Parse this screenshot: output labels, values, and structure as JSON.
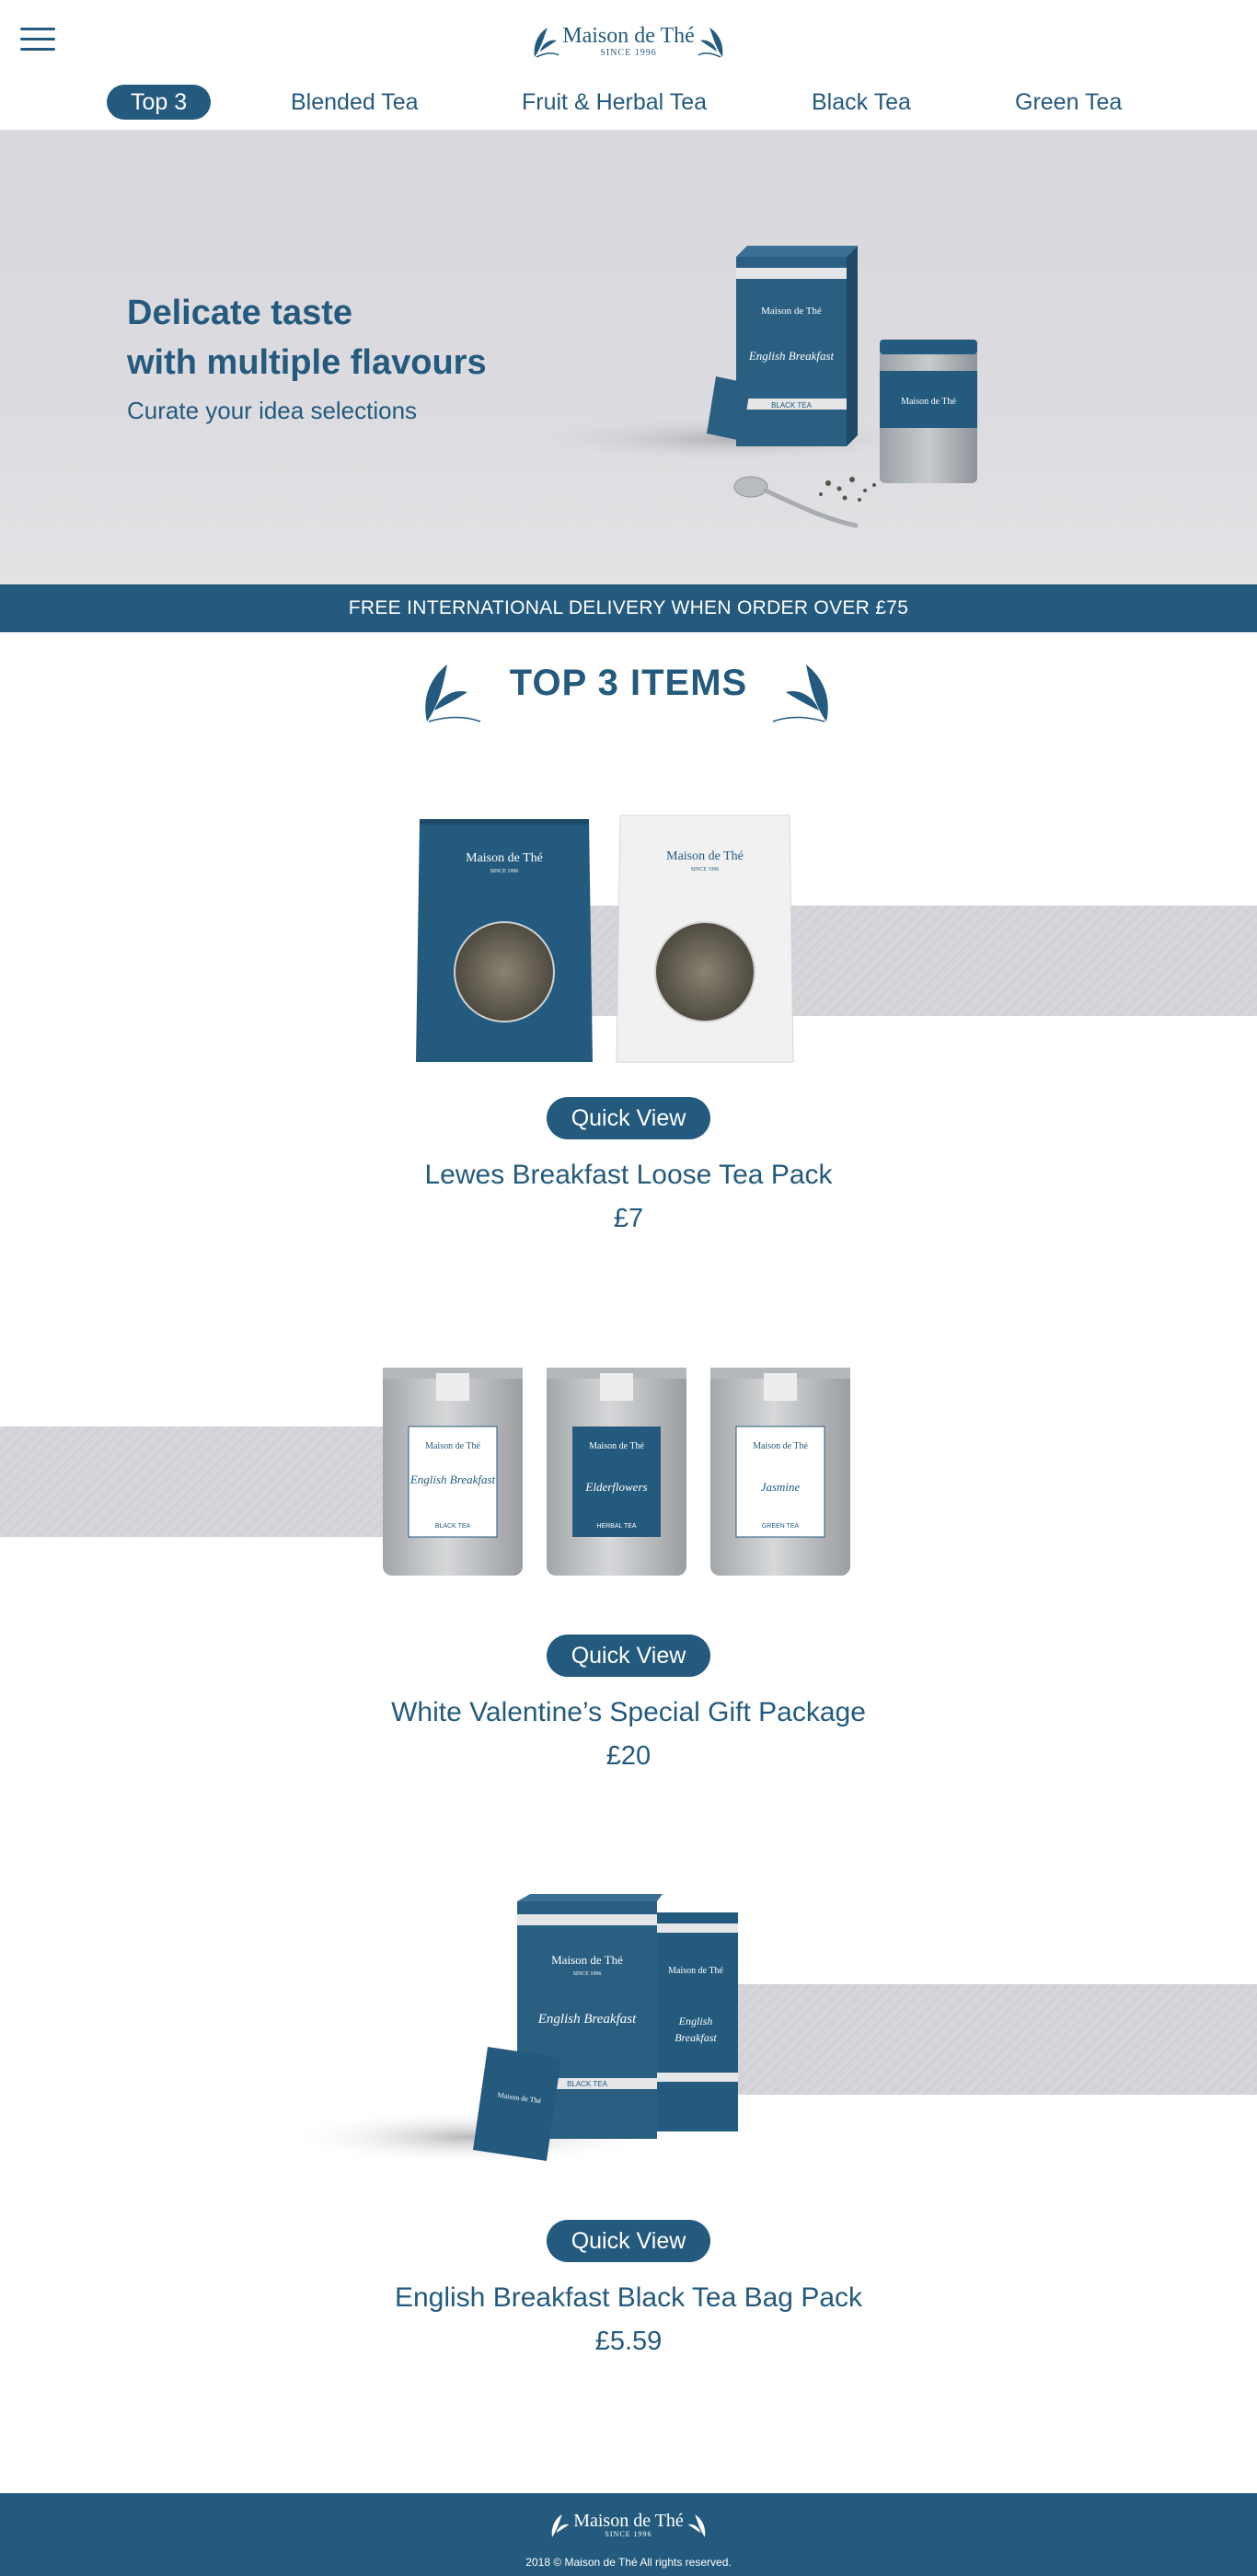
{
  "header": {
    "menu_icon": "hamburger-icon",
    "logo": {
      "brand": "Maison de Thé",
      "since": "SINCE 1996"
    }
  },
  "nav": {
    "items": [
      {
        "label": "Top 3",
        "active": true
      },
      {
        "label": "Blended Tea",
        "active": false
      },
      {
        "label": "Fruit & Herbal Tea",
        "active": false
      },
      {
        "label": "Black Tea",
        "active": false
      },
      {
        "label": "Green Tea",
        "active": false
      }
    ]
  },
  "hero": {
    "headline_line1": "Delicate taste",
    "headline_line2": "with multiple flavours",
    "subheadline": "Curate your idea selections",
    "box_label": "English Breakfast",
    "box_type": "BLACK TEA"
  },
  "promo": {
    "text": "FREE INTERNATIONAL DELIVERY WHEN ORDER OVER £75"
  },
  "section": {
    "title": "TOP 3 ITEMS"
  },
  "products": [
    {
      "name": "Lewes Breakfast Loose Tea Pack",
      "price": "£7",
      "quick_view": "Quick View"
    },
    {
      "name": "White Valentine’s Special Gift Package",
      "price": "£20",
      "quick_view": "Quick View",
      "tins": [
        {
          "label": "English Breakfast",
          "type": "BLACK TEA"
        },
        {
          "label": "Elderflowers",
          "type": "HERBAL TEA"
        },
        {
          "label": "Jasmine",
          "type": "GREEN TEA"
        }
      ]
    },
    {
      "name": "English Breakfast Black Tea Bag Pack",
      "price": "£5.59",
      "quick_view": "Quick View",
      "box_label": "English Breakfast",
      "box_type": "BLACK TEA"
    }
  ],
  "footer": {
    "brand": "Maison de Thé",
    "since": "SINCE 1996",
    "copyright": "2018 © Maison de Thé All rights reserved."
  },
  "colors": {
    "brand": "#245a7d",
    "band": "#d4d4da",
    "hero_bg": "#dcdbdf"
  }
}
